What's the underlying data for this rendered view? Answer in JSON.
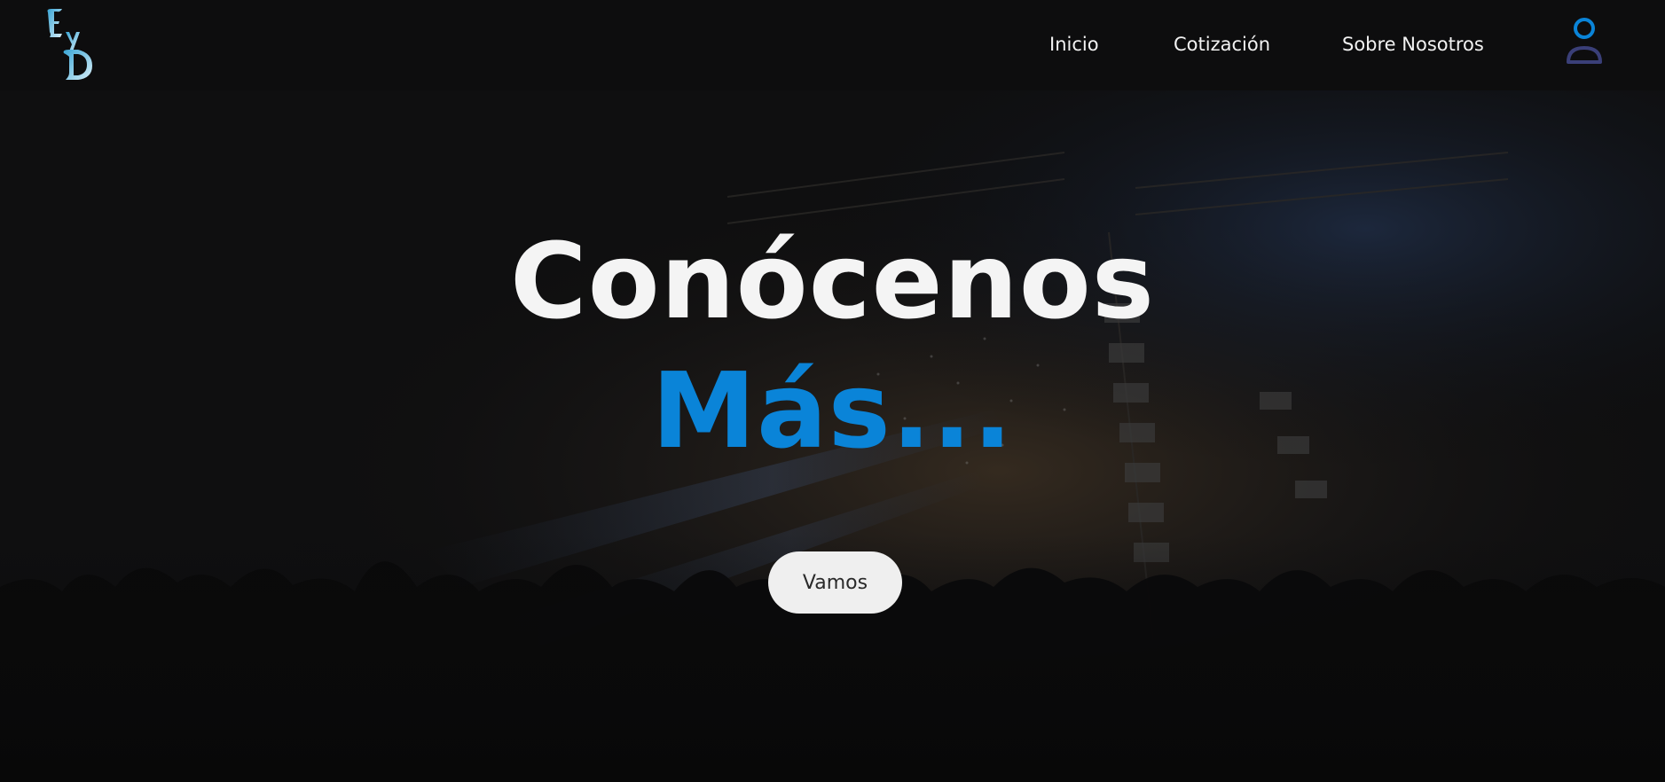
{
  "header": {
    "logo_text": "EyD",
    "nav": [
      {
        "label": "Inicio"
      },
      {
        "label": "Cotización"
      },
      {
        "label": "Sobre Nosotros"
      }
    ],
    "user_icon": "user-icon"
  },
  "hero": {
    "title_line1": "Conócenos",
    "title_line2": "Más...",
    "cta_label": "Vamos",
    "background": "concert-crowd-photo"
  },
  "colors": {
    "accent": "#0a84d8",
    "nav_bg": "#0d0d0e",
    "text": "#f4f4f4",
    "button_bg": "#efefef"
  }
}
